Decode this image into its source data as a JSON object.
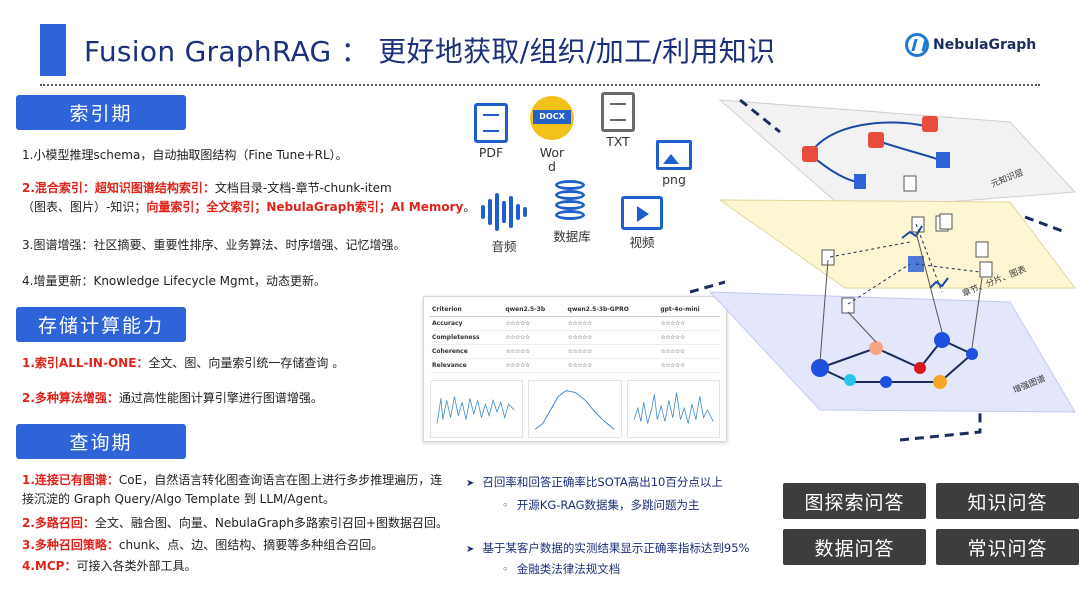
{
  "header": {
    "title": "Fusion GraphRAG ： 更好地获取/组织/加工/利用知识",
    "logo_text": "NebulaGraph"
  },
  "sections": {
    "index": {
      "title": "索引期",
      "items": [
        "1.小模型推理schema，自动抽取图结构（Fine Tune+RL）。",
        {
          "red1": "2.混合索引：超知识图谱结构索引：",
          "plain1": "文档目录-文档-章节-chunk-item",
          "plain2": "（图表、图片）-知识；",
          "red2": "向量索引；全文索引；NebulaGraph索引；AI Memory",
          "end": "。"
        },
        "3.图谱增强：社区摘要、重要性排序、业务算法、时序增强、记忆增强。",
        "4.增量更新：Knowledge Lifecycle Mgmt，动态更新。"
      ]
    },
    "storage": {
      "title": "存储计算能力",
      "items": [
        {
          "red": "1.索引ALL-IN-ONE：",
          "text": "全文、图、向量索引统一存储查询 。"
        },
        {
          "red": "2.多种算法增强：",
          "text": "通过高性能图计算引擎进行图谱增强。"
        }
      ]
    },
    "query": {
      "title": "查询期",
      "items": [
        {
          "red": "1.连接已有图谱：",
          "text": "CoE，自然语言转化图查询语言在图上进行多步推理遍历，连",
          "text2": "接沉淀的 Graph Query/Algo Template 到 LLM/Agent。"
        },
        {
          "red": "2.多路召回：",
          "text": "全文、融合图、向量、NebulaGraph多路索引召回+图数据召回。"
        },
        {
          "red": "3.多种召回策略：",
          "text": "chunk、点、边、图结构、摘要等多种组合召回。"
        },
        {
          "red": "4.MCP：",
          "text": "可接入各类外部工具。"
        }
      ]
    }
  },
  "file_types": {
    "pdf": "PDF",
    "word1": "Wor",
    "word2": "d",
    "docx": "DOCX",
    "txt": "TXT",
    "png": "png",
    "audio": "音频",
    "db": "数据库",
    "video": "视频"
  },
  "eval_table": {
    "headers": [
      "Criterion",
      "qwen2.5-3b",
      "qwen2.5-3b-GPRO",
      "gpt-4o-mini"
    ],
    "rows": [
      {
        "criterion": "Accuracy",
        "scores": [
          "☆☆☆☆☆",
          "☆☆☆☆☆",
          "☆☆☆☆☆"
        ]
      },
      {
        "criterion": "Completeness",
        "scores": [
          "☆☆☆☆☆",
          "☆☆☆☆☆",
          "☆☆☆☆☆"
        ]
      },
      {
        "criterion": "Coherence",
        "scores": [
          "☆☆☆☆☆",
          "☆☆☆☆☆",
          "☆☆☆☆☆"
        ]
      },
      {
        "criterion": "Relevance",
        "scores": [
          "☆☆☆☆☆",
          "☆☆☆☆☆",
          "☆☆☆☆☆"
        ]
      }
    ]
  },
  "results": {
    "b1": "召回率和回答正确率比SOTA高出10百分点以上",
    "b1_sub": "开源KG-RAG数据集，多跳问题为主",
    "b2": "基于某客户数据的实测结果显示正确率指标达到95%",
    "b2_sub": "金融类法律法规文档"
  },
  "layers": {
    "top": "元知识层",
    "middle": "章节、分片、图表",
    "bottom": "增强图谱"
  },
  "qa_buttons": [
    "图探索问答",
    "知识问答",
    "数据问答",
    "常识问答"
  ],
  "colors": {
    "accent": "#2f63d8",
    "highlight_red": "#e0241b",
    "title_navy": "#1c2f7a",
    "qa_dark": "#3d3d3d"
  }
}
